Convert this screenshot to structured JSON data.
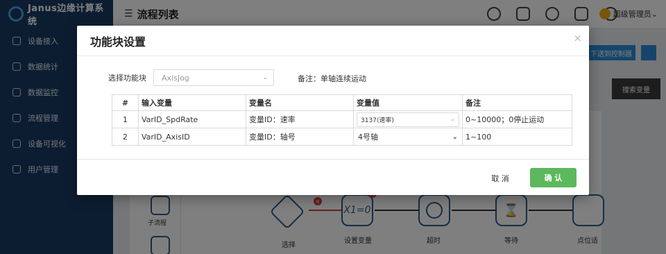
{
  "app": {
    "logo_text": "Janus边缘计算系统"
  },
  "sidebar": {
    "items": [
      {
        "label": "设备接入"
      },
      {
        "label": "数据统计"
      },
      {
        "label": "数据监控"
      },
      {
        "label": "流程管理"
      },
      {
        "label": "设备可视化"
      },
      {
        "label": "用户管理"
      }
    ]
  },
  "header": {
    "title": "流程列表",
    "user_name": "超级管理员",
    "icons": [
      "bell-icon",
      "apps-icon",
      "api-icon",
      "nr-icon",
      "cloud-icon"
    ]
  },
  "toolbar": {
    "send_label": "下送到控制器",
    "search_var_label": "搜索变量"
  },
  "palette": {
    "items": [
      {
        "label": "子流程"
      }
    ]
  },
  "flow": {
    "nodes": [
      {
        "label": "选择",
        "glyph": ""
      },
      {
        "label": "设置变量",
        "glyph": "X1=0"
      },
      {
        "label": "超时",
        "glyph": ""
      },
      {
        "label": "等待",
        "glyph": ""
      },
      {
        "label": "点位适",
        "glyph": ""
      }
    ]
  },
  "modal": {
    "title": "功能块设置",
    "close_glyph": "×",
    "select_label": "选择功能块",
    "select_value": "AxisJog",
    "remark_label": "备注：",
    "remark_value": "单轴连续运动",
    "table": {
      "headers": [
        "#",
        "输入变量",
        "变量名",
        "变量值",
        "备注"
      ],
      "rows": [
        {
          "num": "1",
          "input": "VarID_SpdRate",
          "name": "变量ID：速率",
          "value": "3137(速率)",
          "note": "0~10000；0停止运动"
        },
        {
          "num": "2",
          "input": "VarID_AxisID",
          "name": "变量ID：轴号",
          "value": "4号轴",
          "note": "1~100"
        }
      ]
    },
    "cancel_label": "取 消",
    "ok_label": "确 认"
  },
  "colors": {
    "sidebar": "#1b3a63",
    "primary": "#2c8bd6",
    "confirm": "#5cb85c",
    "error": "#d94040"
  }
}
